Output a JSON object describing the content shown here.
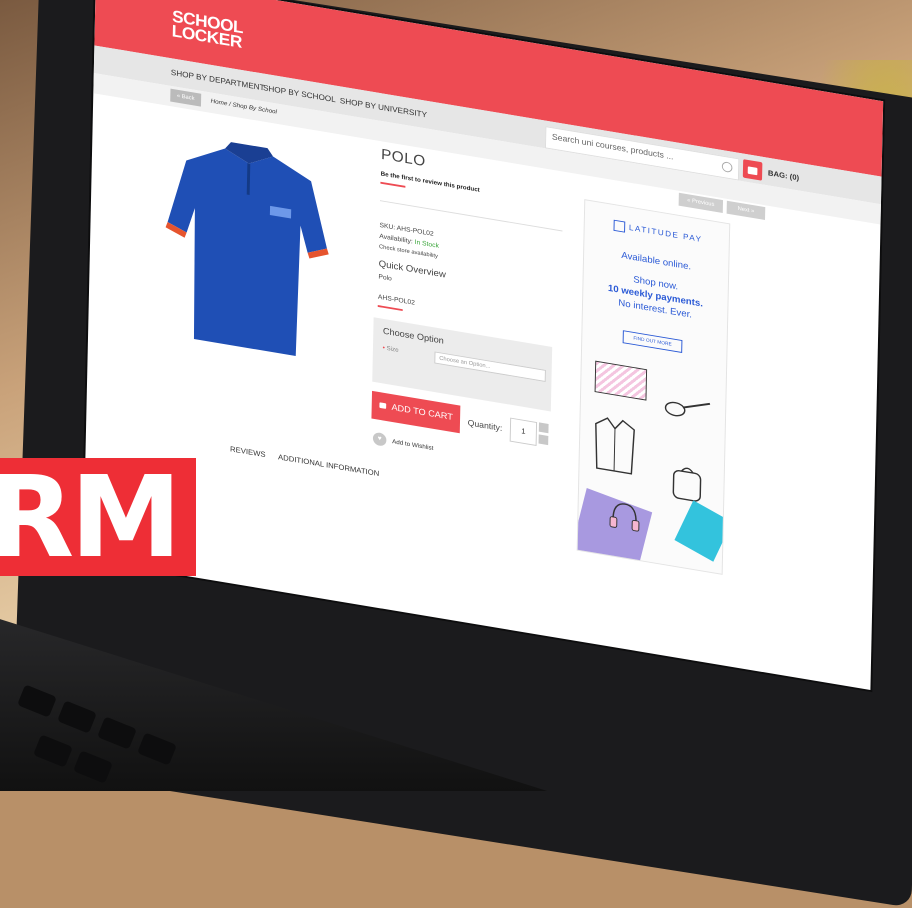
{
  "site": {
    "logo": "SCHOOL LOCKER",
    "nav": [
      "SHOP BY DEPARTMENT",
      "SHOP BY SCHOOL",
      "SHOP BY UNIVERSITY"
    ],
    "search_placeholder": "Search uni courses, products ...",
    "bag_label": "BAG: (0)",
    "back_label": "« Back",
    "breadcrumb": "Home / Shop By School",
    "prev_label": "« Previous",
    "next_label": "Next »"
  },
  "product": {
    "title": "POLO",
    "review_link": "Be the first to review this product",
    "sku": "SKU: AHS-POL02",
    "availability_label": "Availability:",
    "availability_value": "In Stock",
    "check_store": "Check store availability",
    "quick_overview_title": "Quick Overview",
    "quick_overview_text": "Polo",
    "code": "AHS-POL02",
    "choose_option_title": "Choose Option",
    "size_label": "Size",
    "size_placeholder": "Choose an Option...",
    "add_to_cart": "ADD TO CART",
    "quantity_label": "Quantity:",
    "quantity_value": "1",
    "wishlist_label": "Add to Wishlist",
    "tabs": [
      "REVIEWS",
      "ADDITIONAL INFORMATION"
    ]
  },
  "ad": {
    "brand": "LATITUDE PAY",
    "line1": "Available online.",
    "line2": "Shop now.",
    "line3": "10 weekly payments.",
    "line4": "No interest. Ever.",
    "cta": "FIND OUT MORE"
  },
  "overlay": {
    "badge_text": "RM"
  },
  "colors": {
    "brand_red": "#ee4b53",
    "latitude_blue": "#2b5ad6",
    "stock_green": "#3aa53a"
  }
}
